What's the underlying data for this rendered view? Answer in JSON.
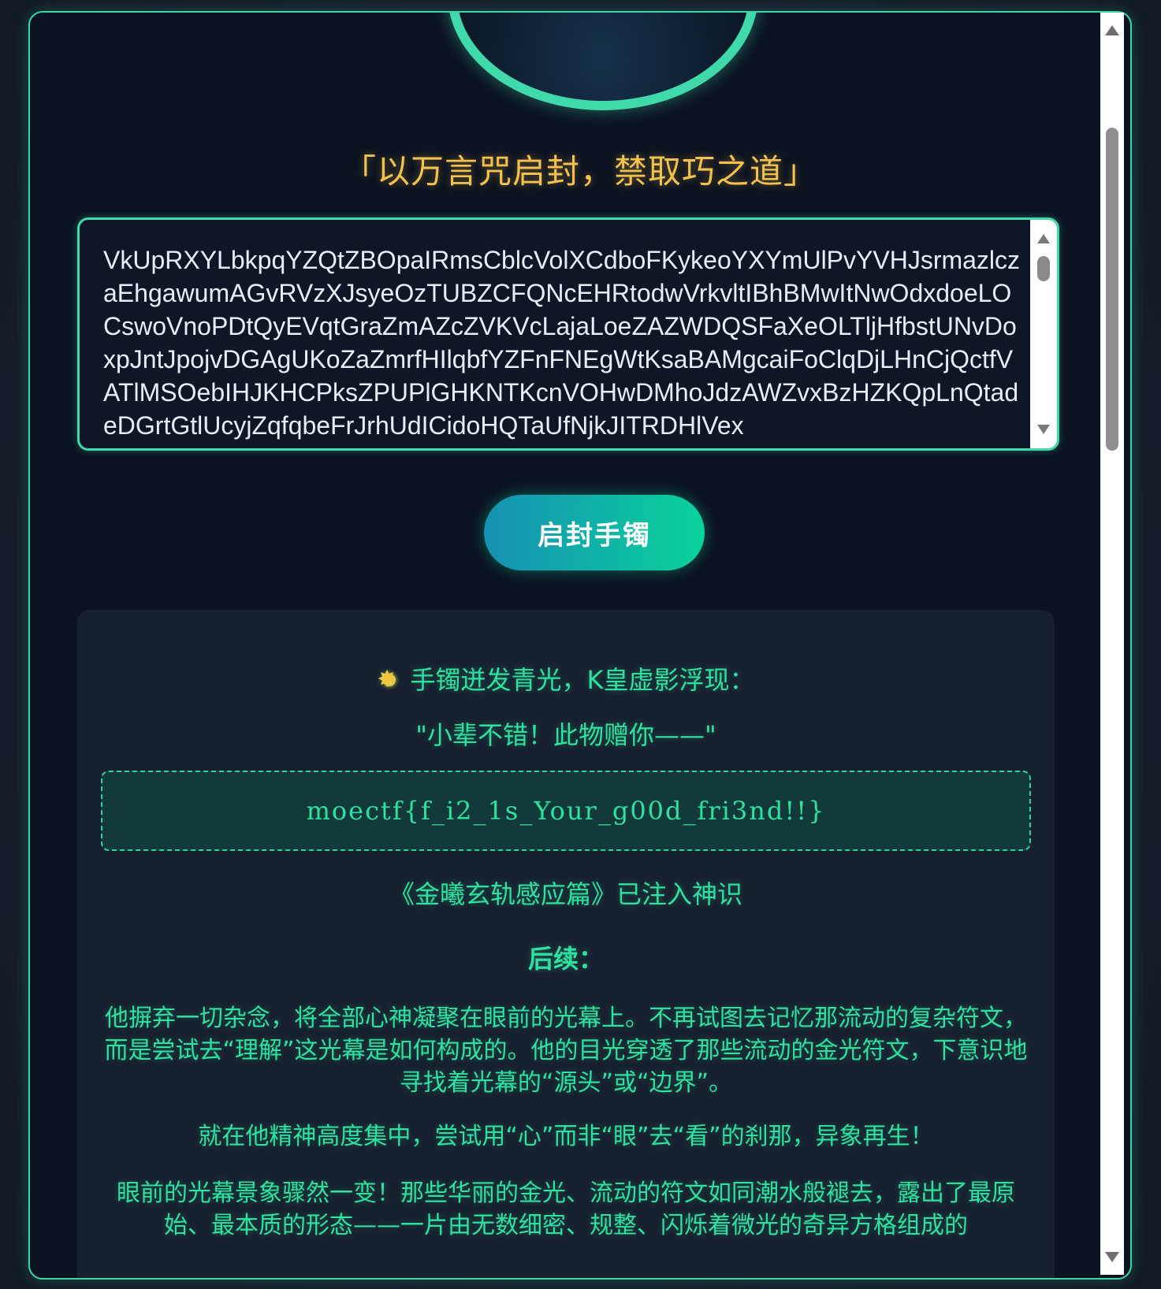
{
  "motto": "「以万言咒启封，禁取巧之道」",
  "input_text": "VkUpRXYLbkpqYZQtZBOpaIRmsCblcVolXCdboFKykeoYXYmUlPvYVHJsrmazlczaEhgawumAGvRVzXJsyeOzTUBZCFQNcEHRtodwVrkvltIBhBMwItNwOdxdoeLOCswoVnoPDtQyEVqtGraZmAZcZVKVcLajaLoeZAZWDQSFaXeOLTljHfbstUNvDoxpJntJpojvDGAgUKoZaZmrfHIlqbfYZFnFNEgWtKsaBAMgcaiFoClqDjLHnCjQctfVATlMSOebIHJKHCPksZPUPlGHKNTKcnVOHwDMhoJdzAWZvxBzHZKQpLnQtadeDGrtGtlUcyjZqfqbeFrJrhUdICidoHQTaUfNjkJITRDHlVex",
  "button": {
    "unseal_label": "启封手镯"
  },
  "result": {
    "heading": "手镯迸发青光，K皇虚影浮现：",
    "quote": "\"小辈不错！此物赠你——\"",
    "flag": "moectf{f_i2_1s_Your_g00d_fri3nd!!}",
    "injected": "《金曦玄轨感应篇》已注入神识",
    "subheading": "后续：",
    "paragraphs": [
      "他摒弃一切杂念，将全部心神凝聚在眼前的光幕上。不再试图去记忆那流动的复杂符文，而是尝试去“理解”这光幕是如何构成的。他的目光穿透了那些流动的金光符文，下意识地寻找着光幕的“源头”或“边界”。",
      "就在他精神高度集中，尝试用“心”而非“眼”去“看”的刹那，异象再生！",
      "眼前的光幕景象骤然一变！那些华丽的金光、流动的符文如同潮水般褪去，露出了最原始、最本质的形态——一片由无数细密、规整、闪烁着微光的奇异方格组成的"
    ]
  },
  "colors": {
    "accent": "#3fd9ab",
    "gold": "#f2c14e",
    "text_green": "#2fe0a0",
    "panel_bg": "#0b1220"
  }
}
